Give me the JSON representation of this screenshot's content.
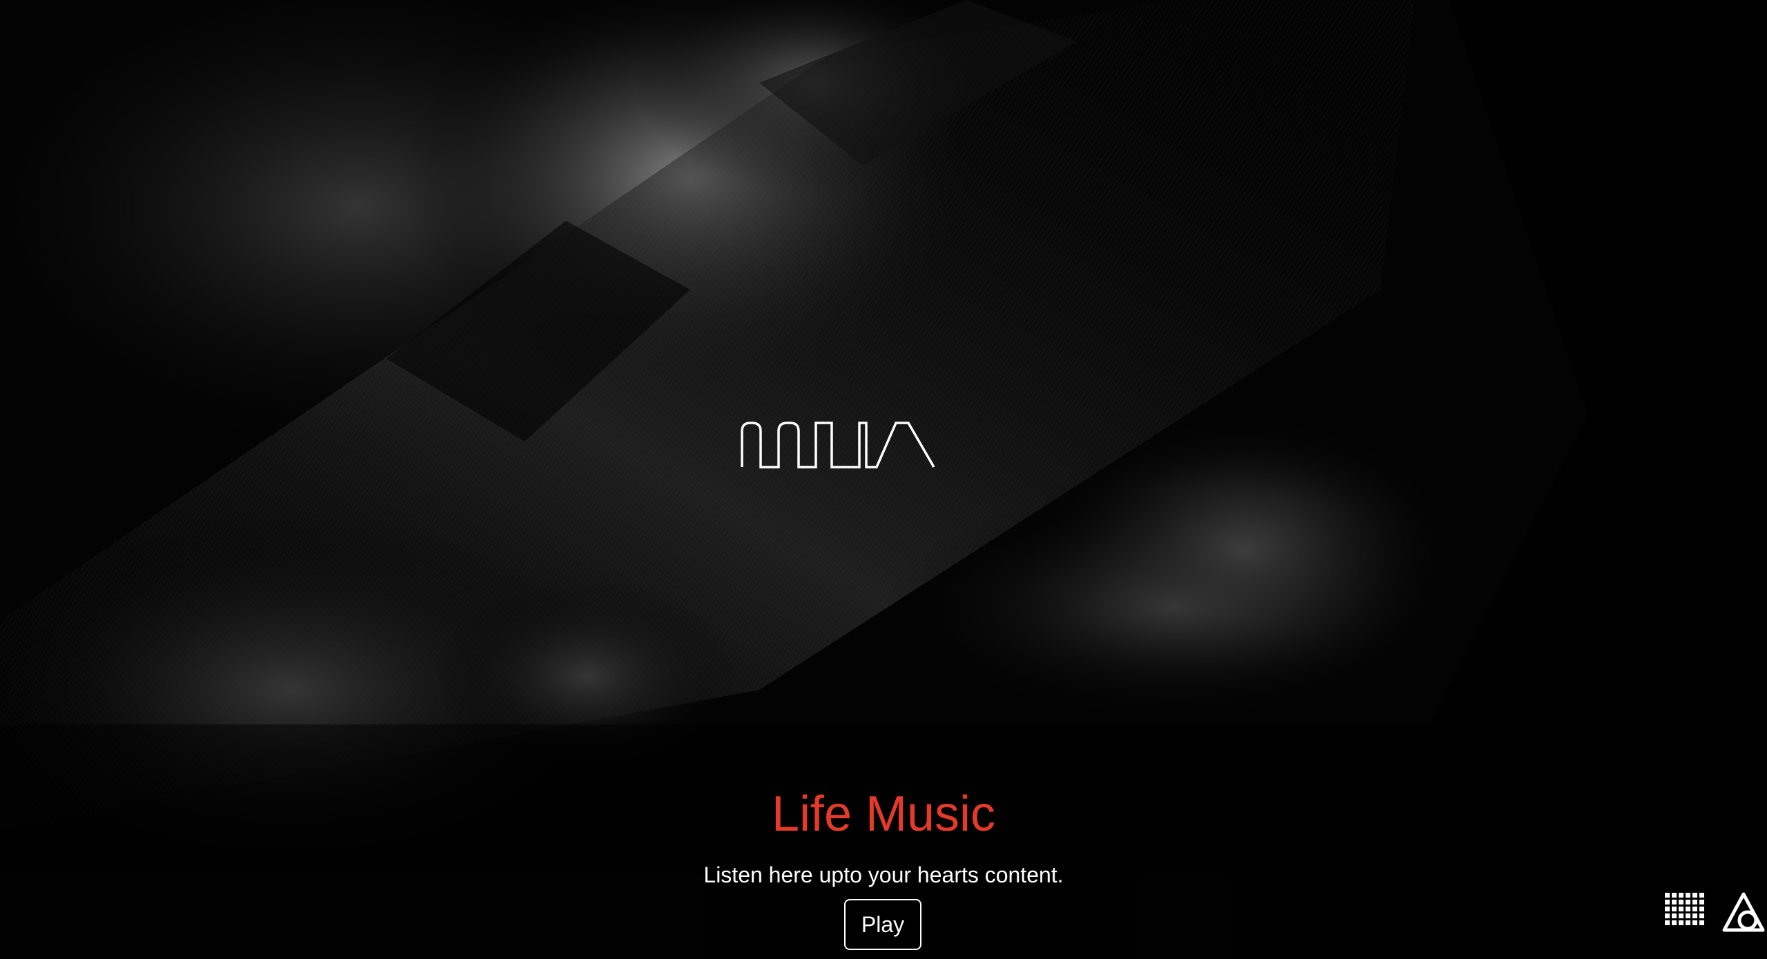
{
  "hero": {
    "title": "Life Music",
    "subtitle": "Listen here upto your hearts content.",
    "play_label": "Play"
  },
  "icons": {
    "logo": "waveform-logo",
    "grid": "dot-grid-icon",
    "corner": "brand-mark-icon"
  },
  "colors": {
    "accent": "#e53a2a",
    "background": "#000000",
    "text": "#ffffff"
  }
}
